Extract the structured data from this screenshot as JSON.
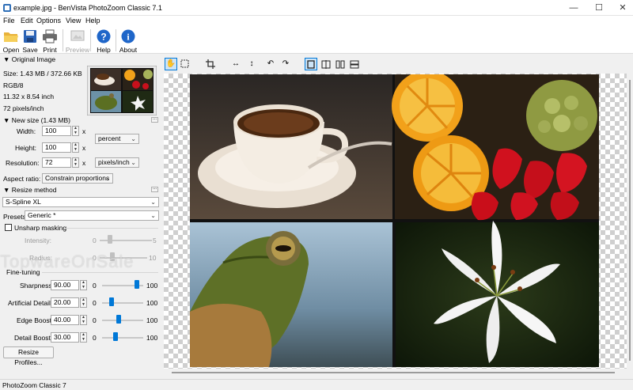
{
  "window": {
    "title": "example.jpg - BenVista PhotoZoom Classic 7.1",
    "minimize": "—",
    "maximize": "☐",
    "close": "✕"
  },
  "menu": [
    "File",
    "Edit",
    "Options",
    "View",
    "Help"
  ],
  "toolbar": {
    "open": "Open",
    "save": "Save",
    "print": "Print",
    "preview": "Preview",
    "help": "Help",
    "about": "About"
  },
  "original": {
    "header": "Original Image",
    "size": "Size: 1.43 MB / 372.66 KB",
    "mode": "RGB/8",
    "dimensions": "11.32 x 8.54 inch",
    "resolution": "72 pixels/inch"
  },
  "new_size": {
    "header": "New size (1.43 MB)",
    "width_label": "Width:",
    "width": "100",
    "height_label": "Height:",
    "height": "100",
    "unit": "percent",
    "resolution_label": "Resolution:",
    "resolution": "72",
    "res_unit": "pixels/inch",
    "aspect_label": "Aspect ratio:",
    "aspect": "Constrain proportions",
    "link_glyph": "x"
  },
  "resize": {
    "header": "Resize method",
    "method": "S-Spline XL",
    "presets_label": "Presets:",
    "preset": "Generic *",
    "unsharp_label": "Unsharp masking",
    "intensity_label": "Intensity:",
    "intensity_min": "0",
    "intensity_max": "5",
    "radius_label": "Radius:",
    "radius_min": "0",
    "radius_max": "10",
    "finetuning": "Fine-tuning",
    "sharpness_label": "Sharpness:",
    "sharpness": "90.00",
    "artificial_label": "Artificial Detail:",
    "artificial": "20.00",
    "edge_label": "Edge Boost:",
    "edge": "40.00",
    "detail_label": "Detail Boost:",
    "detail": "30.00",
    "slider_min": "0",
    "slider_max": "100",
    "sharpness_level": 0.9,
    "artificial_level": 0.2,
    "edge_level": 0.4,
    "detail_level": 0.3
  },
  "profiles_button": "Resize Profiles...",
  "more_button": "...",
  "status": "PhotoZoom Classic 7",
  "watermark": "TopwareOnSale"
}
